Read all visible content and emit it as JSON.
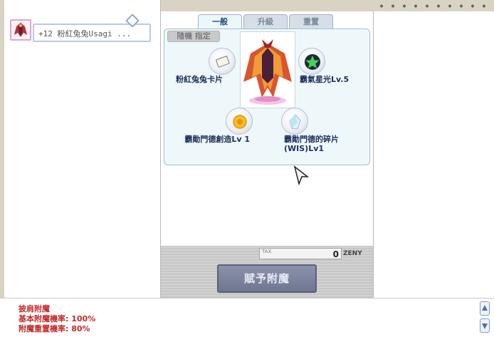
{
  "left_panel": {
    "item_name": "+12 粉紅兔兔Usagi ..."
  },
  "tabs": [
    {
      "label": "一般",
      "active": true
    },
    {
      "label": "升級",
      "active": false
    },
    {
      "label": "重置",
      "active": false
    }
  ],
  "random_button": "隨機 指定",
  "options": [
    {
      "label": "粉紅兔兔卡片",
      "icon": "card-icon"
    },
    {
      "label": "霸氣星光Lv.5",
      "icon": "star-icon"
    },
    {
      "label": "霸勛門德創造Lv 1",
      "icon": "gold-coin-icon"
    },
    {
      "label": "霸勛門德的碎片(WIS)Lv1",
      "icon": "crystal-shard-icon"
    }
  ],
  "tax": {
    "label": "TAX",
    "value": "0",
    "unit": "ZENY"
  },
  "grant_button": "賦予附魔",
  "messages": [
    "披肩附魔",
    "基本附魔機率: 100%",
    "附魔重置機率: 80%"
  ],
  "colors": {
    "active_tab": "#eaf7fb",
    "message_text": "#c42a2a",
    "grant_button": "#7a8199"
  }
}
